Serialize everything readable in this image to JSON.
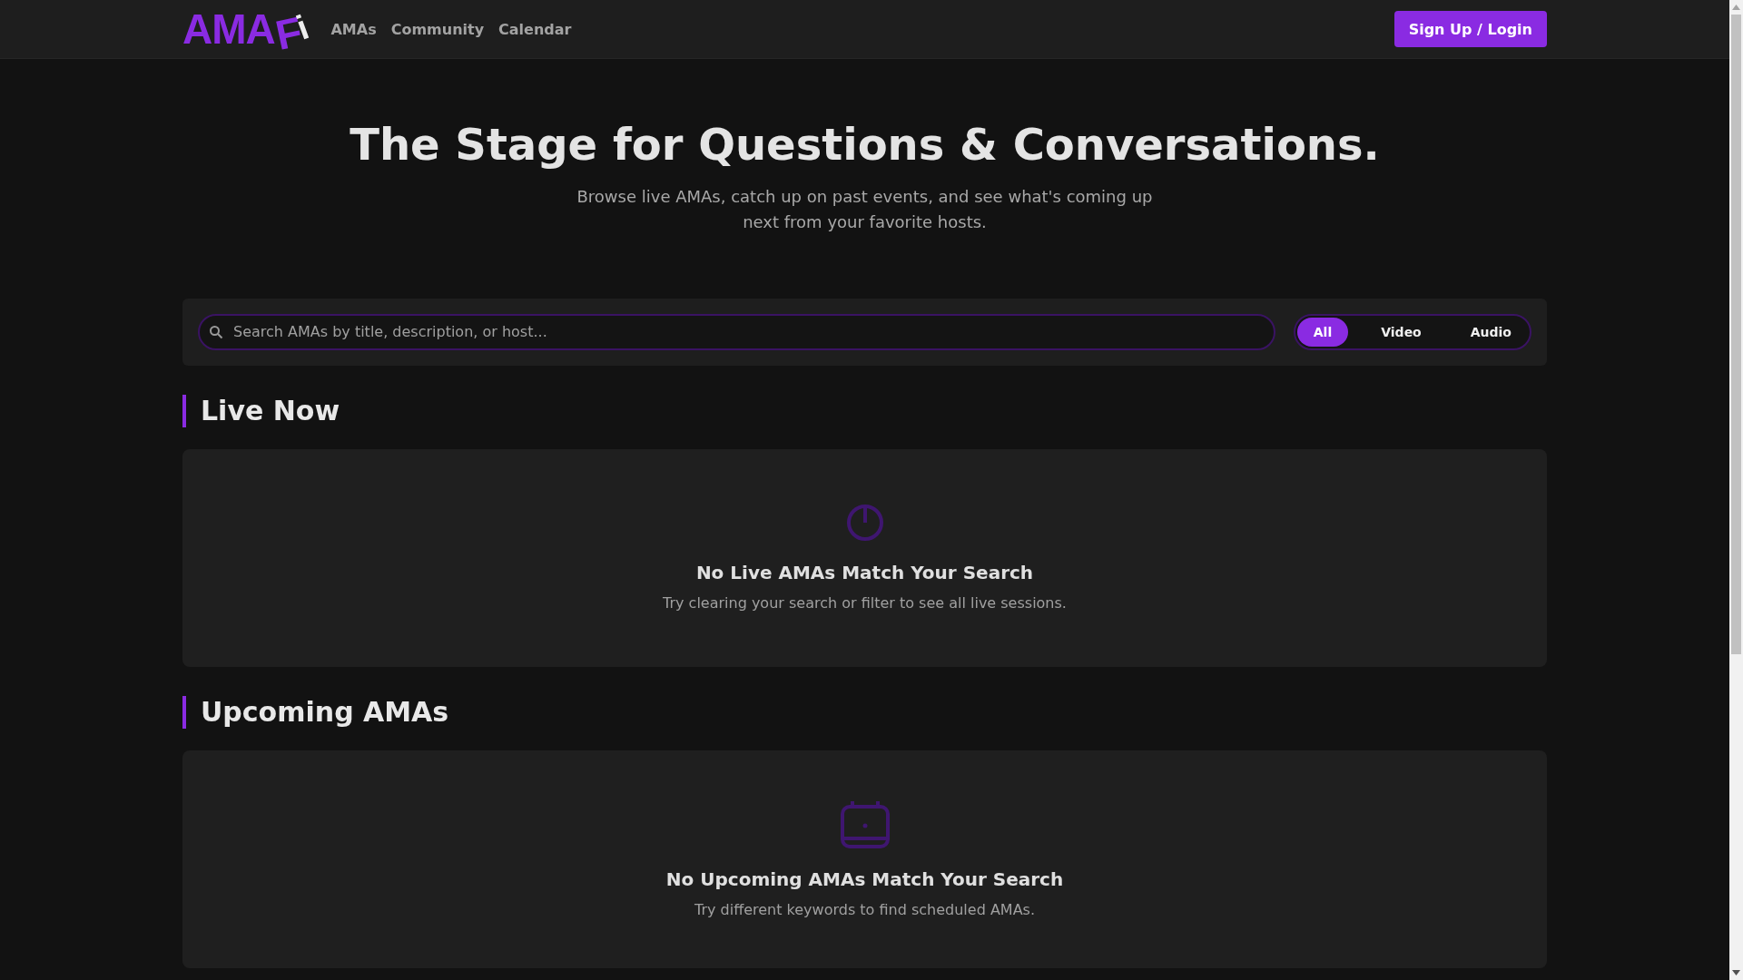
{
  "nav": {
    "logo": [
      "AMA",
      "F",
      "i"
    ],
    "links": [
      {
        "label": "AMAs"
      },
      {
        "label": "Community"
      },
      {
        "label": "Calendar"
      }
    ],
    "login_button": "Sign Up / Login"
  },
  "hero": {
    "title": "The Stage for Questions & Conversations.",
    "subtitle": "Browse live AMAs, catch up on past events, and see what's coming up next from your favorite hosts."
  },
  "search": {
    "placeholder": "Search AMAs by title, description, or host..."
  },
  "filters": [
    {
      "label": "All",
      "selected": true
    },
    {
      "label": "Video",
      "selected": false
    },
    {
      "label": "Audio",
      "selected": false
    }
  ],
  "sections": [
    {
      "title": "Live Now",
      "kind": "clock",
      "empty_title": "No Live AMAs Match Your Search",
      "empty_text": "Try clearing your search or filter to see all live sessions."
    },
    {
      "title": "Upcoming AMAs",
      "kind": "calendar",
      "empty_title": "No Upcoming AMAs Match Your Search",
      "empty_text": "Try different keywords to find scheduled AMAs."
    }
  ]
}
